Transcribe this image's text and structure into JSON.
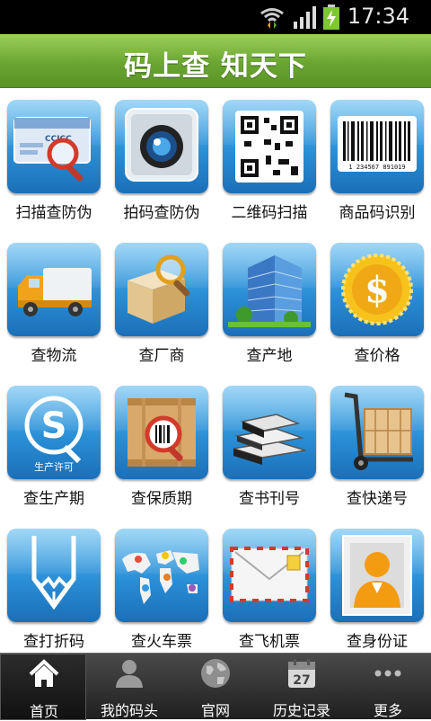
{
  "status_bar": {
    "time": "17:34"
  },
  "header": {
    "title": "码上查 知天下"
  },
  "grid": {
    "items": [
      {
        "label": "扫描查防伪",
        "icon": "id-card-magnifier-icon"
      },
      {
        "label": "拍码查防伪",
        "icon": "camera-icon"
      },
      {
        "label": "二维码扫描",
        "icon": "qr-code-icon"
      },
      {
        "label": "商品码识别",
        "icon": "barcode-icon"
      },
      {
        "label": "查物流",
        "icon": "truck-icon"
      },
      {
        "label": "查厂商",
        "icon": "box-magnifier-icon"
      },
      {
        "label": "查产地",
        "icon": "building-icon"
      },
      {
        "label": "查价格",
        "icon": "dollar-coin-icon"
      },
      {
        "label": "查生产期",
        "icon": "qs-license-icon"
      },
      {
        "label": "查保质期",
        "icon": "crate-barcode-icon"
      },
      {
        "label": "查书刊号",
        "icon": "books-icon"
      },
      {
        "label": "查快递号",
        "icon": "hand-truck-icon"
      },
      {
        "label": "查打折码",
        "icon": "pencil-icon"
      },
      {
        "label": "查火车票",
        "icon": "world-map-icon"
      },
      {
        "label": "查飞机票",
        "icon": "airmail-envelope-icon"
      },
      {
        "label": "查身份证",
        "icon": "id-portrait-icon"
      }
    ],
    "qs_text": "生产许可",
    "barcode_digits": "1 234567 891019",
    "card_text": "CCICC"
  },
  "tab_bar": {
    "items": [
      {
        "label": "首页",
        "icon": "home-icon",
        "active": true
      },
      {
        "label": "我的码头",
        "icon": "user-icon",
        "active": false
      },
      {
        "label": "官网",
        "icon": "globe-icon",
        "active": false
      },
      {
        "label": "历史记录",
        "icon": "calendar-icon",
        "active": false,
        "calendar_day": "27"
      },
      {
        "label": "更多",
        "icon": "more-dots-icon",
        "active": false
      }
    ]
  },
  "colors": {
    "header_green": "#6aa531",
    "tile_blue": "#2a8fd6",
    "tabbar_dark": "#1f1f1f"
  }
}
